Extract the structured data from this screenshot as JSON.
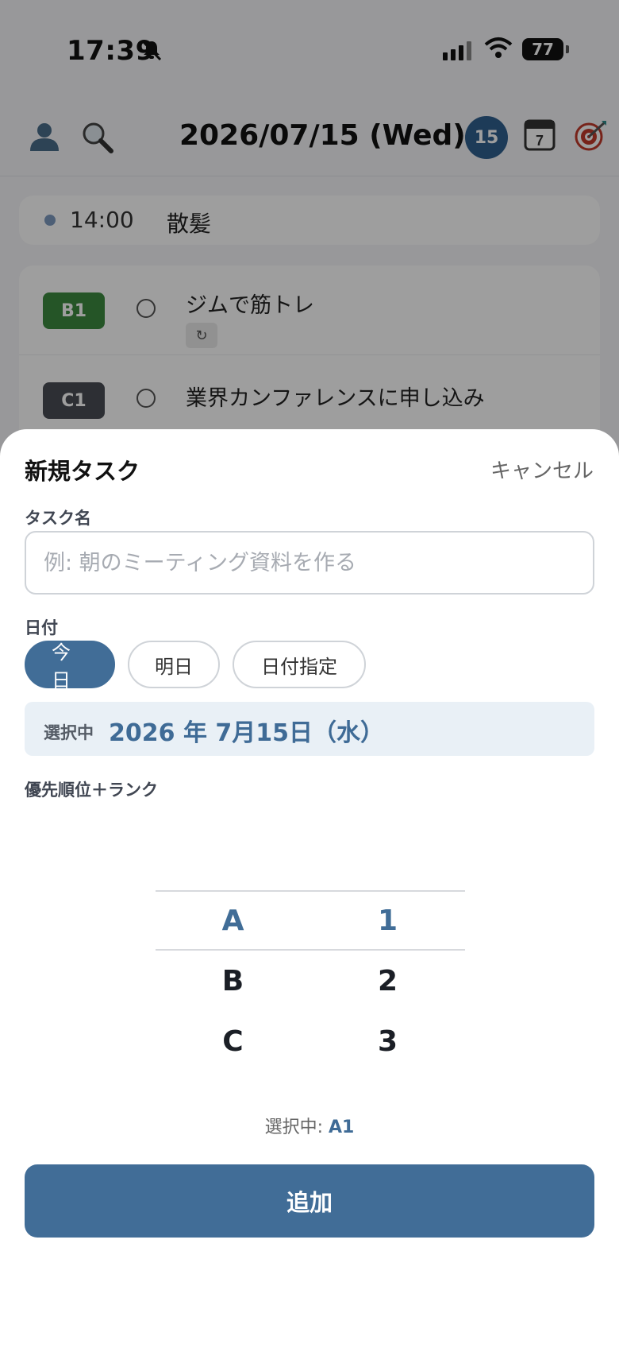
{
  "status_bar": {
    "time": "17:39",
    "battery": "77"
  },
  "header": {
    "date": "2026/07/15 (Wed)",
    "day_badge": "15",
    "calendar_icon_day": "7"
  },
  "event": {
    "time": "14:00",
    "title": "散髪"
  },
  "tasks": [
    {
      "rank": "B1",
      "title": "ジムで筋トレ",
      "rank_color": "#3c8a3f",
      "repeat": true
    },
    {
      "rank": "C1",
      "title": "業界カンファレンスに申し込み",
      "rank_color": "#4a4d54",
      "repeat": false
    }
  ],
  "sheet": {
    "title": "新規タスク",
    "cancel": "キャンセル",
    "task_name_label": "タスク名",
    "task_name_placeholder": "例: 朝のミーティング資料を作る",
    "date_label": "日付",
    "date_options": [
      "今日",
      "明日",
      "日付指定"
    ],
    "selected_date_prefix": "選択中",
    "selected_date": "2026 年 7月15日（水）",
    "priority_label": "優先順位＋ランク",
    "priority_letters": [
      "A",
      "B",
      "C"
    ],
    "priority_numbers": [
      "1",
      "2",
      "3"
    ],
    "selected_priority_prefix": "選択中:",
    "selected_priority": "A1",
    "add_button": "追加"
  },
  "colors": {
    "accent": "#416d97",
    "accent_text": "#3f6b96"
  }
}
